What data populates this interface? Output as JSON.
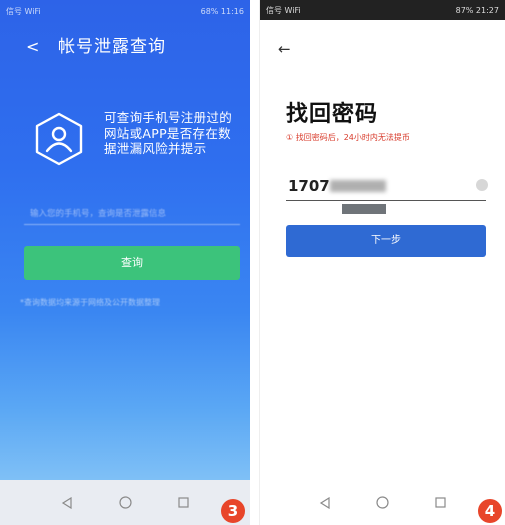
{
  "left_screen": {
    "status": {
      "left": "信号 WiFi",
      "right": "68% 11:16"
    },
    "header": {
      "title": "帐号泄露查询"
    },
    "description": "可查询手机号注册过的网站或APP是否存在数据泄漏风险并提示",
    "input_placeholder": "输入您的手机号，查询是否泄露信息",
    "query_button": "查询",
    "footnote": "*查询数据均来源于网络及公开数据整理",
    "badge": "3",
    "colors": {
      "gradient_top": "#2d63e8",
      "button": "#3cc37b",
      "badge": "#e8452a"
    }
  },
  "right_screen": {
    "status": {
      "left": "信号 WiFi",
      "right": "87% 21:27"
    },
    "title": "找回密码",
    "warning": "① 找回密码后，24小时内无法提币",
    "phone_value": "1707",
    "next_button": "下一步",
    "badge": "4",
    "colors": {
      "button": "#2f6ad3",
      "warning": "#d83a2a",
      "badge": "#e8452a"
    }
  },
  "nav": {
    "icons": [
      "back-triangle",
      "home-circle",
      "recents-square"
    ]
  }
}
